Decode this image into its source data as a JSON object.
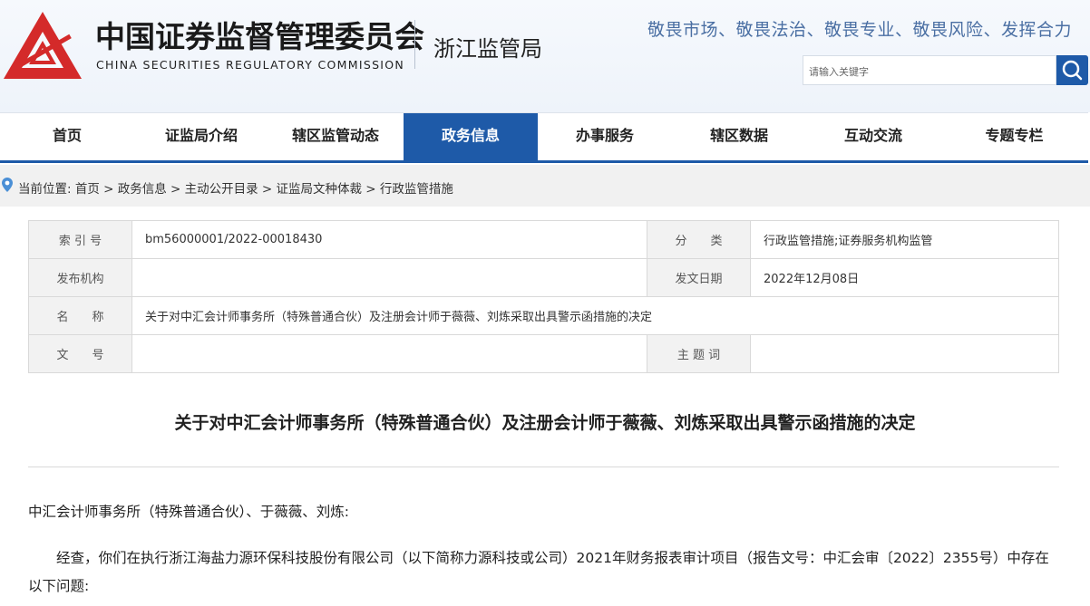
{
  "header": {
    "org_cn": "中国证券监督管理委员会",
    "org_en": "CHINA SECURITIES REGULATORY COMMISSION",
    "bureau": "浙江监管局",
    "slogan": "敬畏市场、敬畏法治、敬畏专业、敬畏风险、发挥合力",
    "search_placeholder": "请输入关键字",
    "logo_color": "#d42a2a",
    "accent": "#1e5aa8"
  },
  "nav": [
    {
      "label": "首页"
    },
    {
      "label": "证监局介绍"
    },
    {
      "label": "辖区监管动态"
    },
    {
      "label": "政务信息"
    },
    {
      "label": "办事服务"
    },
    {
      "label": "辖区数据"
    },
    {
      "label": "互动交流"
    },
    {
      "label": "专题专栏"
    }
  ],
  "breadcrumb": "当前位置: 首页 > 政务信息 > 主动公开目录 > 证监局文种体裁 > 行政监管措施",
  "meta": {
    "index_label": "索 引 号",
    "index_value": "bm56000001/2022-00018430",
    "category_label": "分　　类",
    "category_value": "行政监管措施;证券服务机构监管",
    "issuer_label": "发布机构",
    "issuer_value": "",
    "date_label": "发文日期",
    "date_value": "2022年12月08日",
    "name_label": "名　　称",
    "name_value": "关于对中汇会计师事务所（特殊普通合伙）及注册会计师于薇薇、刘炼采取出具警示函措施的决定",
    "docno_label": "文　　号",
    "docno_value": "",
    "subject_label": "主 题 词",
    "subject_value": ""
  },
  "article": {
    "title": "关于对中汇会计师事务所（特殊普通合伙）及注册会计师于薇薇、刘炼采取出具警示函措施的决定",
    "salutation": "中汇会计师事务所（特殊普通合伙）、于薇薇、刘炼:",
    "para1": "经查，你们在执行浙江海盐力源环保科技股份有限公司（以下简称力源科技或公司）2021年财务报表审计项目（报告文号：中汇会审〔2022〕2355号）中存在以下问题:"
  }
}
